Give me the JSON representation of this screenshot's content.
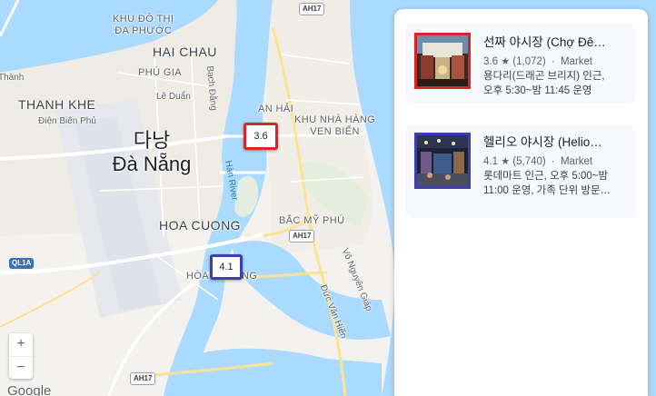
{
  "map": {
    "labels": {
      "khu_do_thi_line1": "KHU ĐÔ THỊ",
      "khu_do_thi_line2": "ĐA PHƯỚC",
      "hai_chau": "HAI CHAU",
      "phu_gia": "PHÚ GIA",
      "le_duan": "Lê Duẩn",
      "thanh_khe": "THANH KHE",
      "dien_bien_phu": "Điện Biên Phủ",
      "bach_dang": "Bạch Đằng",
      "an_hai": "AN HẢI",
      "khu_nha_hang_line1": "KHU NHÀ HÀNG",
      "khu_nha_hang_line2": "VEN BIỂN",
      "city_korean": "다낭",
      "city_vietnamese": "Đà Nẵng",
      "han_river": "Hàn River",
      "hoa_cuong": "HOA CUONG",
      "bac_my_phu": "BẮC MỸ PHÚ",
      "hoa_xuan_partial_left": "HÒA",
      "hoa_xuan_partial_right": "NG",
      "vo_nguyen_giap": "Võ Nguyên Giáp",
      "duong_van_hien": "Đức Văn Hiến",
      "thanh_partial": "Thành"
    },
    "road_shields": {
      "ah17_top": "AH17",
      "ah17_mid": "AH17",
      "ah17_bottom": "AH17",
      "ql1a": "QL1A"
    },
    "pins": [
      {
        "rating": "3.6",
        "highlight": "#d9232a"
      },
      {
        "rating": "4.1",
        "highlight": "#3d3fae"
      }
    ],
    "zoom_in": "+",
    "zoom_out": "−",
    "attribution": "Google",
    "colors": {
      "water": "#aadaff",
      "land": "#f5f5f3",
      "urban": "#efece6",
      "airport": "#e8eaf0",
      "park": "#d5ead3",
      "major_road": "#ffffff",
      "highway": "#fde293"
    }
  },
  "results": [
    {
      "title": "선짜 야시장 (Chợ Đê…",
      "rating": "3.6",
      "reviews": "(1,072)",
      "separator": "·",
      "category": "Market",
      "desc_line1": "용다리(드래곤 브리지) 인근,",
      "desc_line2": "오후 5:30~밤 11:45 운영",
      "thumb_icon": "night-market-photo-icon",
      "highlight": "#d9232a"
    },
    {
      "title": "헬리오 야시장 (Helio…",
      "rating": "4.1",
      "reviews": "(5,740)",
      "separator": "·",
      "category": "Market",
      "desc_line1": "롯데마트 인근, 오후 5:00~밤",
      "desc_line2": "11:00 운영, 가족 단위 방문…",
      "thumb_icon": "night-market-photo-icon",
      "highlight": "#3d3fae"
    }
  ]
}
